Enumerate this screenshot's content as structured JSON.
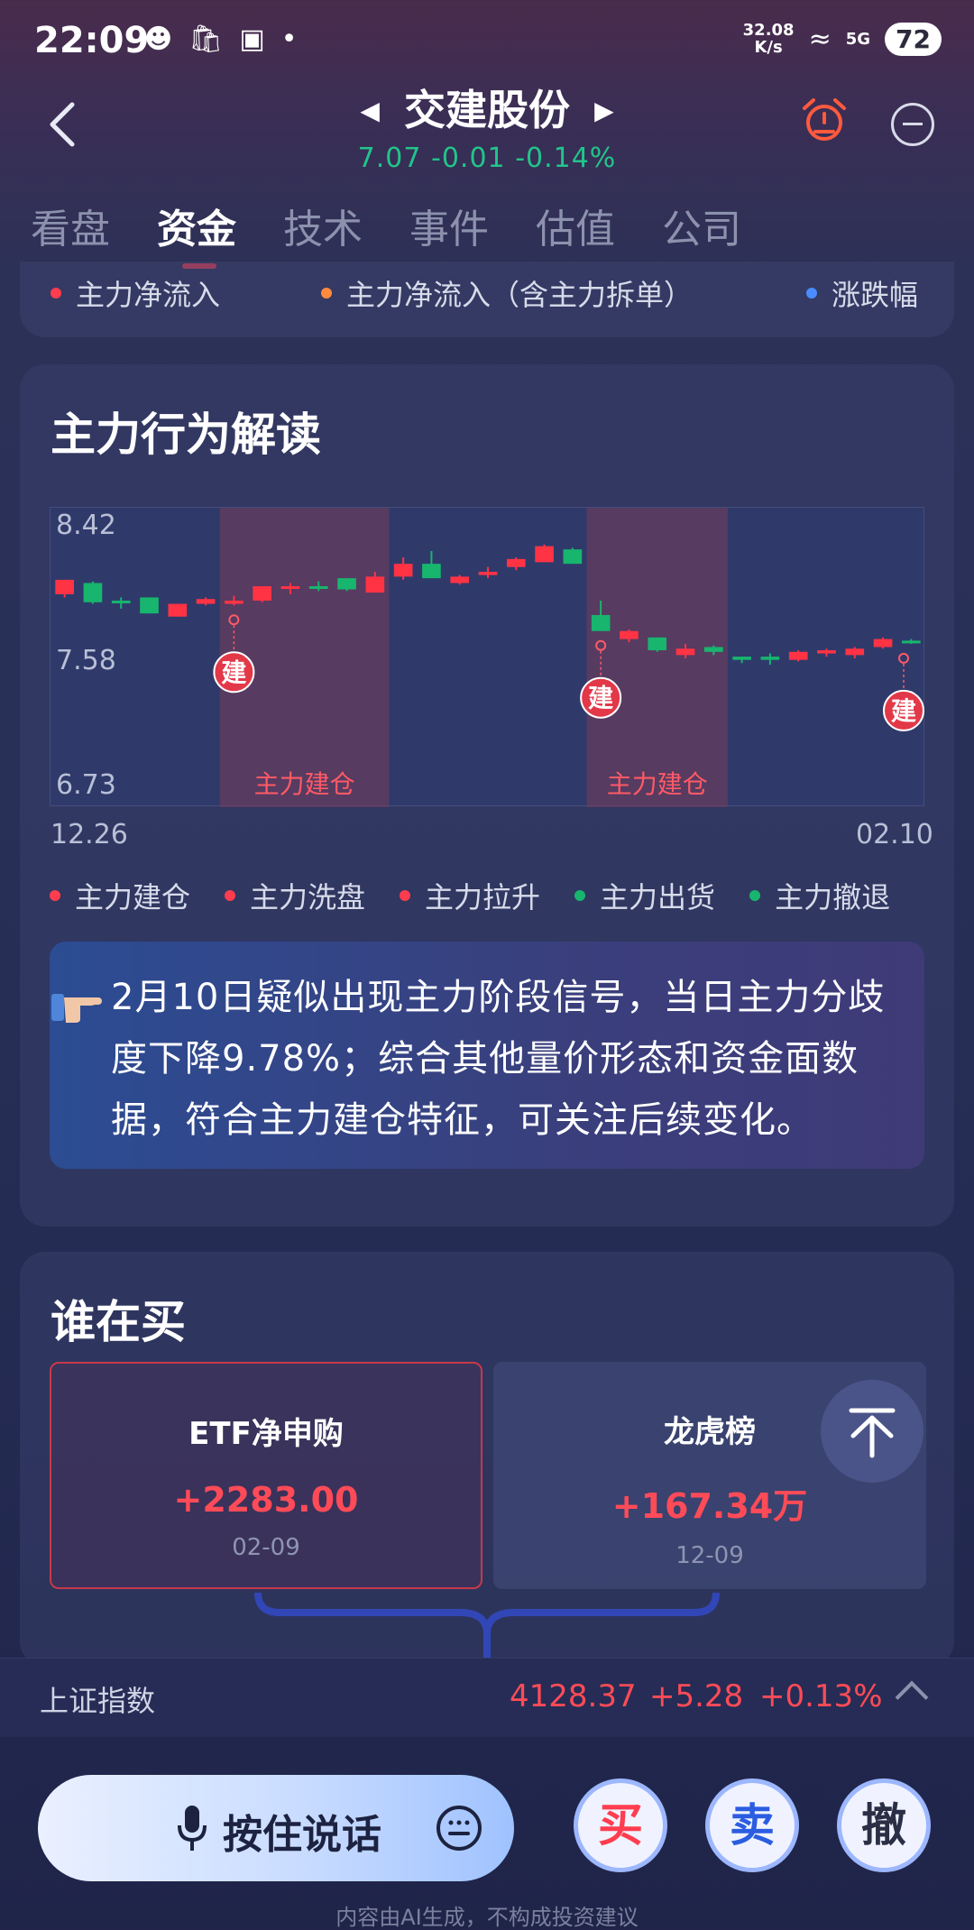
{
  "status_bar": {
    "time": "22:09",
    "network_speed": "32.08",
    "network_unit": "K/s",
    "signal": "5G",
    "battery": "72"
  },
  "header": {
    "title": "交建股份",
    "price": "7.07",
    "change": "-0.01",
    "change_pct": "-0.14%"
  },
  "tabs": [
    "看盘",
    "资金",
    "技术",
    "事件",
    "估值",
    "公司"
  ],
  "active_tab": 1,
  "flow_legend": [
    {
      "label": "主力净流入",
      "color": "#ff3d4f"
    },
    {
      "label": "主力净流入（含主力拆单）",
      "color": "#ff8a3d"
    },
    {
      "label": "涨跌幅",
      "color": "#4a8cff"
    }
  ],
  "behavior": {
    "title": "主力行为解读",
    "chart_data": {
      "type": "candlestick",
      "y_ticks": [
        "8.42",
        "7.58",
        "6.73"
      ],
      "ylim": [
        6.73,
        8.42
      ],
      "x_ticks": [
        "12.26",
        "02.10"
      ],
      "phases": [
        {
          "label": "主力建仓",
          "start_index": 6,
          "end_index": 11
        },
        {
          "label": "主力建仓",
          "start_index": 19,
          "end_index": 23
        }
      ],
      "markers": [
        {
          "label": "建",
          "index": 6
        },
        {
          "label": "建",
          "index": 19
        },
        {
          "label": "建",
          "index": 30
        }
      ],
      "candles": [
        {
          "o": 7.97,
          "c": 8.06,
          "h": 8.06,
          "l": 7.95
        },
        {
          "o": 8.04,
          "c": 7.92,
          "h": 8.05,
          "l": 7.91
        },
        {
          "o": 7.93,
          "c": 7.92,
          "h": 7.95,
          "l": 7.88
        },
        {
          "o": 7.95,
          "c": 7.85,
          "h": 7.95,
          "l": 7.85
        },
        {
          "o": 7.83,
          "c": 7.91,
          "h": 7.91,
          "l": 7.83
        },
        {
          "o": 7.91,
          "c": 7.94,
          "h": 7.95,
          "l": 7.9
        },
        {
          "o": 7.91,
          "c": 7.93,
          "h": 7.96,
          "l": 7.9
        },
        {
          "o": 7.93,
          "c": 8.02,
          "h": 8.02,
          "l": 7.92
        },
        {
          "o": 8.01,
          "c": 8.02,
          "h": 8.04,
          "l": 7.97
        },
        {
          "o": 8.02,
          "c": 8.01,
          "h": 8.05,
          "l": 7.99
        },
        {
          "o": 8.07,
          "c": 8.0,
          "h": 8.07,
          "l": 7.99
        },
        {
          "o": 7.98,
          "c": 8.08,
          "h": 8.11,
          "l": 7.98
        },
        {
          "o": 8.08,
          "c": 8.16,
          "h": 8.2,
          "l": 8.06
        },
        {
          "o": 8.16,
          "c": 8.07,
          "h": 8.24,
          "l": 8.07
        },
        {
          "o": 8.04,
          "c": 8.08,
          "h": 8.09,
          "l": 8.03
        },
        {
          "o": 8.09,
          "c": 8.11,
          "h": 8.14,
          "l": 8.07
        },
        {
          "o": 8.14,
          "c": 8.19,
          "h": 8.2,
          "l": 8.12
        },
        {
          "o": 8.17,
          "c": 8.27,
          "h": 8.28,
          "l": 8.17
        },
        {
          "o": 8.25,
          "c": 8.16,
          "h": 8.26,
          "l": 8.16
        },
        {
          "o": 7.84,
          "c": 7.74,
          "h": 7.93,
          "l": 7.74
        },
        {
          "o": 7.69,
          "c": 7.74,
          "h": 7.75,
          "l": 7.67
        },
        {
          "o": 7.7,
          "c": 7.62,
          "h": 7.7,
          "l": 7.61
        },
        {
          "o": 7.59,
          "c": 7.63,
          "h": 7.66,
          "l": 7.57
        },
        {
          "o": 7.64,
          "c": 7.61,
          "h": 7.65,
          "l": 7.59
        },
        {
          "o": 7.58,
          "c": 7.56,
          "h": 7.58,
          "l": 7.54
        },
        {
          "o": 7.58,
          "c": 7.56,
          "h": 7.6,
          "l": 7.53
        },
        {
          "o": 7.56,
          "c": 7.61,
          "h": 7.62,
          "l": 7.55
        },
        {
          "o": 7.6,
          "c": 7.62,
          "h": 7.63,
          "l": 7.58
        },
        {
          "o": 7.59,
          "c": 7.63,
          "h": 7.64,
          "l": 7.57
        },
        {
          "o": 7.64,
          "c": 7.69,
          "h": 7.7,
          "l": 7.63
        },
        {
          "o": 7.68,
          "c": 7.67,
          "h": 7.69,
          "l": 7.66
        }
      ],
      "up_color": "#ff3344",
      "down_color": "#18b56e"
    },
    "behavior_legend": [
      {
        "label": "主力建仓",
        "color": "#ff3d4f"
      },
      {
        "label": "主力洗盘",
        "color": "#ff3d4f"
      },
      {
        "label": "主力拉升",
        "color": "#ff3d4f"
      },
      {
        "label": "主力出货",
        "color": "#18b56e"
      },
      {
        "label": "主力撤退",
        "color": "#18b56e"
      }
    ],
    "insight": "2月10日疑似出现主力阶段信号，当日主力分歧度下降9.78%；综合其他量价形态和资金面数据，符合主力建仓特征，可关注后续变化。"
  },
  "who_buys": {
    "title": "谁在买",
    "cards": [
      {
        "title": "ETF净申购",
        "value": "+2283.00",
        "date": "02-09"
      },
      {
        "title": "龙虎榜",
        "value": "+167.34万",
        "date": "12-09"
      }
    ]
  },
  "index_bar": {
    "name": "上证指数",
    "value": "4128.37",
    "change": "+5.28",
    "change_pct": "+0.13%"
  },
  "bottom": {
    "voice_label": "按住说话",
    "buy": "买",
    "sell": "卖",
    "cancel": "撤",
    "disclaimer": "内容由AI生成，不构成投资建议"
  }
}
